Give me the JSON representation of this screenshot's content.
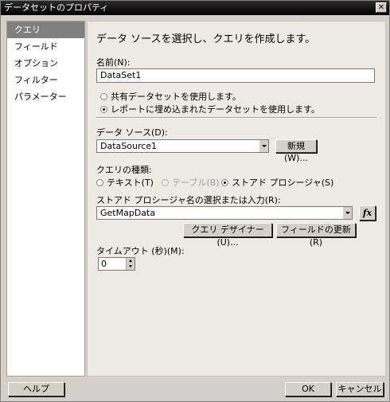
{
  "window": {
    "title": "データセットのプロパティ",
    "close_glyph": "✕"
  },
  "sidebar": {
    "items": [
      {
        "label": "クエリ"
      },
      {
        "label": "フィールド"
      },
      {
        "label": "オプション"
      },
      {
        "label": "フィルター"
      },
      {
        "label": "パラメーター"
      }
    ]
  },
  "main": {
    "heading": "データ ソースを選択し、クエリを作成します。",
    "name_label": "名前(N):",
    "name_value": "DataSet1",
    "shared_option": "共有データセットを使用します。",
    "embedded_option": "レポートに埋め込まれたデータセットを使用します。",
    "datasource_label": "データ ソース(D):",
    "datasource_value": "DataSource1",
    "new_button": "新規(W)...",
    "query_type_label": "クエリの種類:",
    "qt_text": "テキスト(T)",
    "qt_table": "テーブル(B)",
    "qt_stored": "ストアド プロシージャ(S)",
    "sp_label": "ストアド プロシージャ名の選択または入力(R):",
    "sp_value": "GetMapData",
    "fx": "fx",
    "query_designer_button": "クエリ デザイナー(U)...",
    "refresh_fields_button": "フィールドの更新(R)",
    "timeout_label": "タイムアウト (秒)(M):",
    "timeout_value": "0"
  },
  "footer": {
    "help": "ヘルプ",
    "ok": "OK",
    "cancel": "キャンセル"
  }
}
